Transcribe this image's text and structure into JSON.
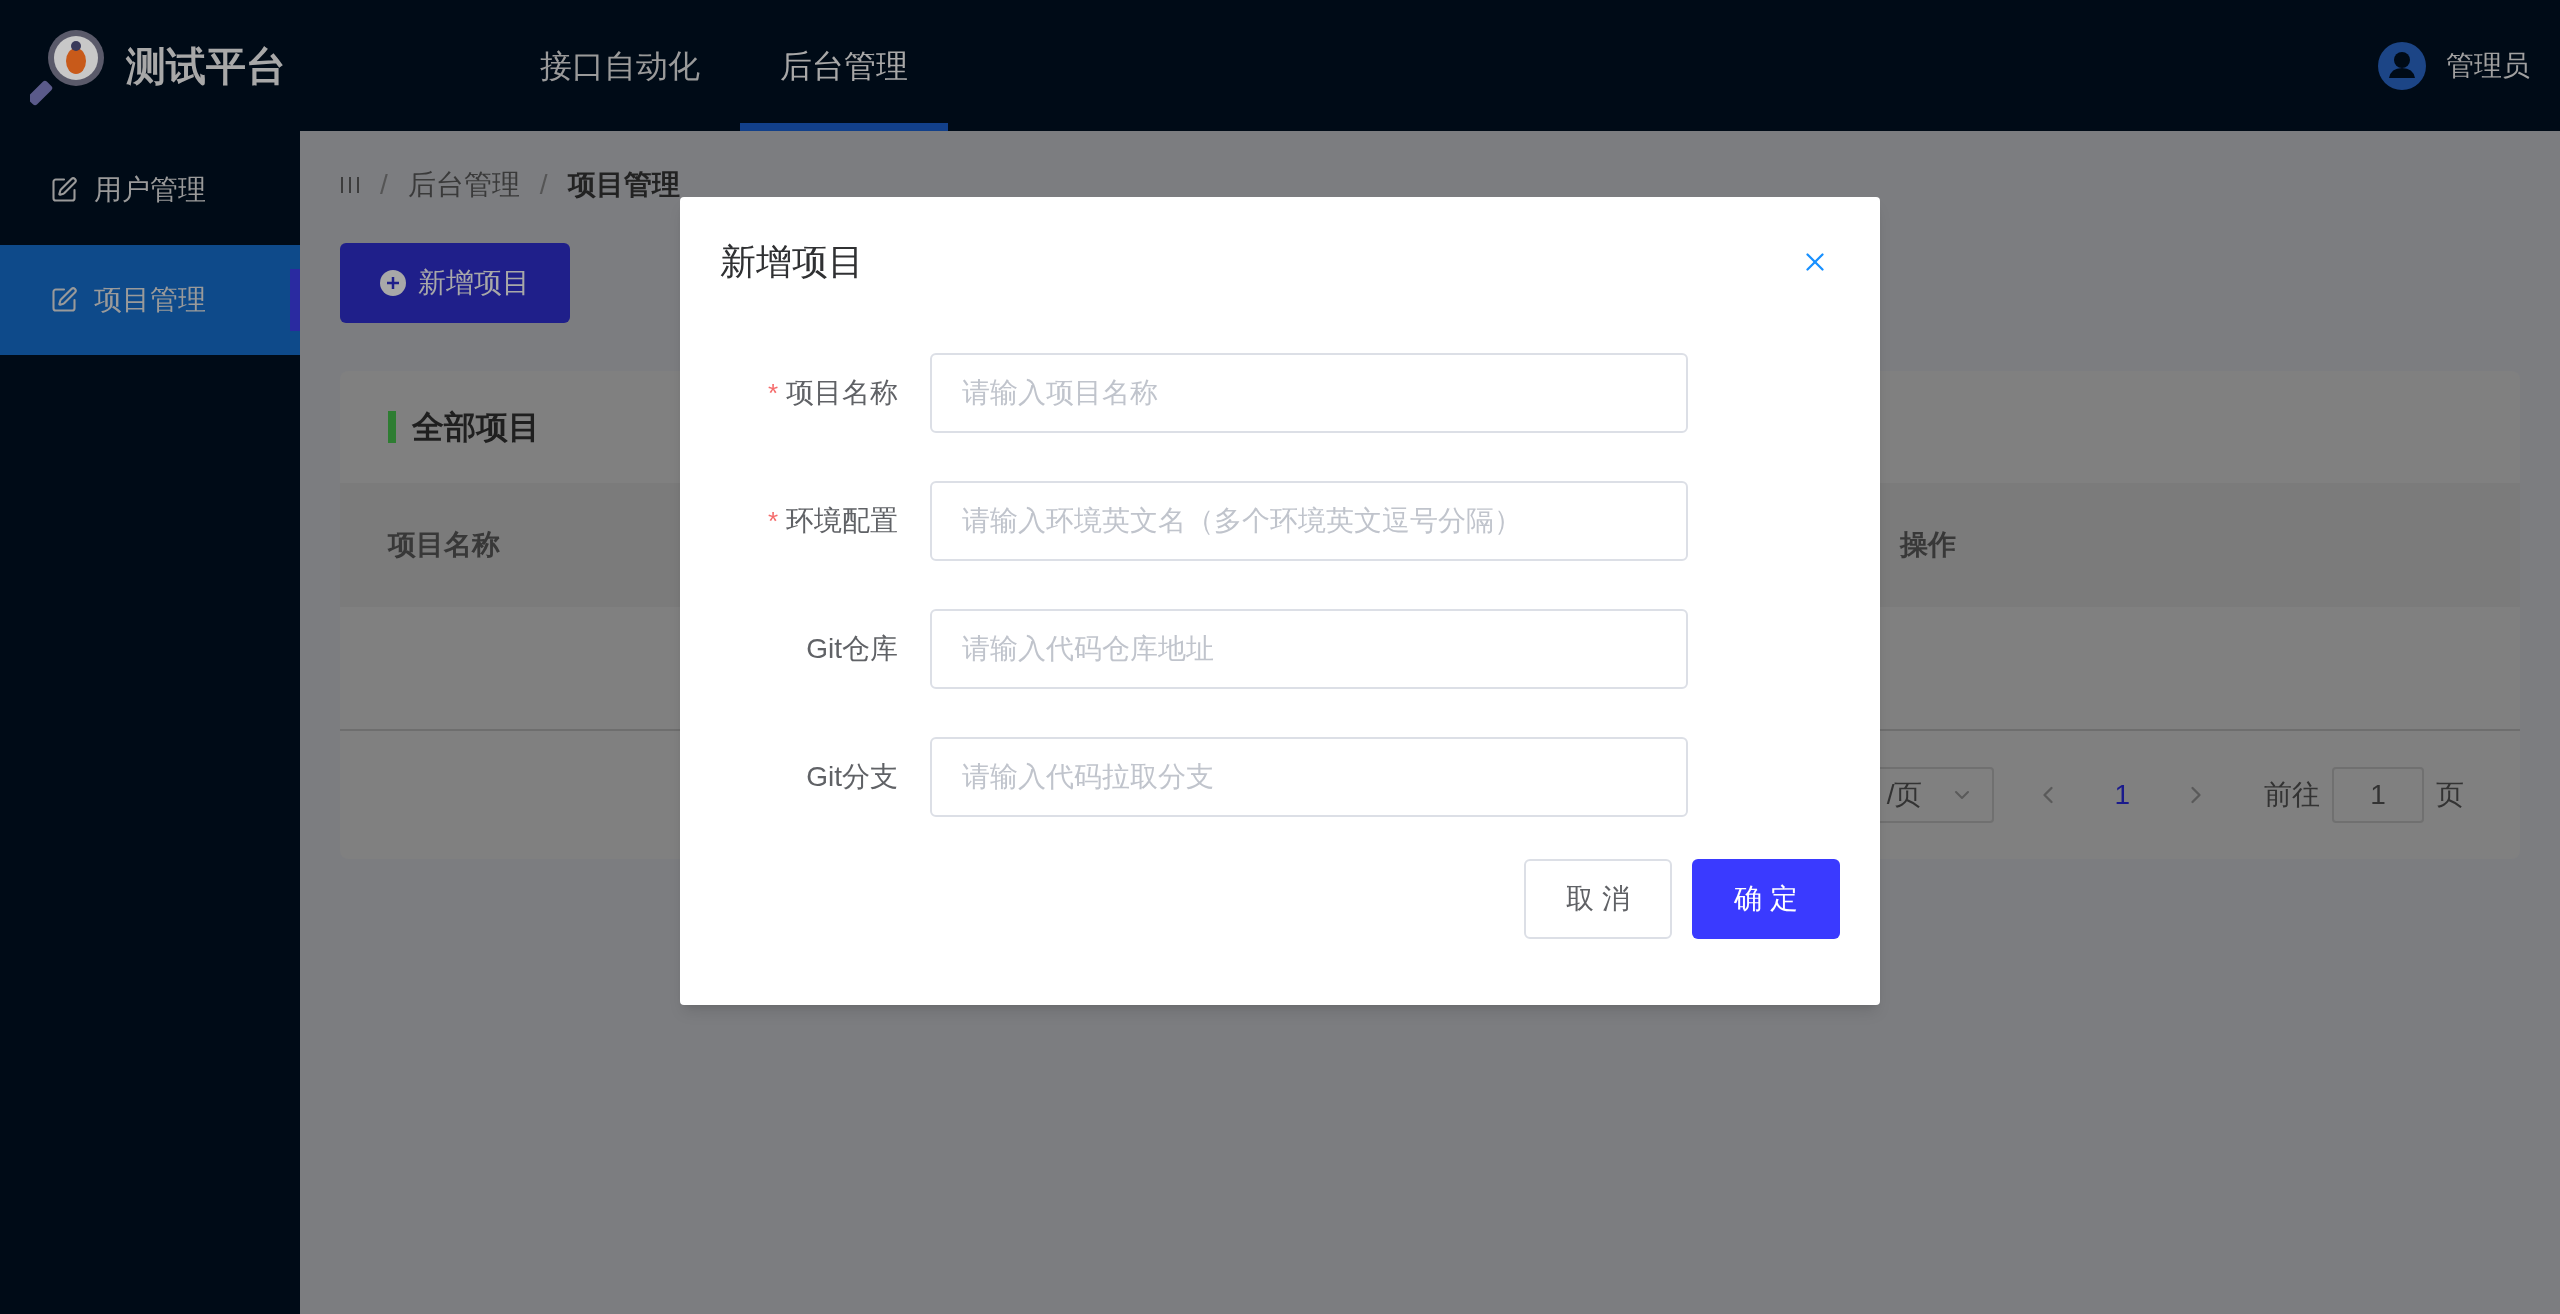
{
  "header": {
    "logo_title": "测试平台",
    "nav": [
      {
        "label": "接口自动化",
        "selected": false
      },
      {
        "label": "后台管理",
        "selected": true
      }
    ],
    "user": "管理员"
  },
  "sidebar": {
    "items": [
      {
        "label": "用户管理",
        "selected": false
      },
      {
        "label": "项目管理",
        "selected": true
      }
    ]
  },
  "breadcrumb": {
    "separator": "/",
    "items": [
      "后台管理",
      "项目管理"
    ]
  },
  "new_button": "新增项目",
  "card": {
    "title": "全部项目",
    "columns": [
      "项目名称",
      "操作"
    ],
    "pagination": {
      "page_size_suffix": "/页",
      "pages": [
        {
          "label": "1",
          "selected": true
        }
      ],
      "goto_label": "前往",
      "goto_value": "1",
      "page_suffix": "页"
    }
  },
  "dialog": {
    "title": "新增项目",
    "required_mark": "*",
    "fields": [
      {
        "label": "项目名称",
        "required": true,
        "placeholder": "请输入项目名称"
      },
      {
        "label": "环境配置",
        "required": true,
        "placeholder": "请输入环境英文名（多个环境英文逗号分隔）"
      },
      {
        "label": "Git仓库",
        "required": false,
        "placeholder": "请输入代码仓库地址"
      },
      {
        "label": "Git分支",
        "required": false,
        "placeholder": "请输入代码拉取分支"
      }
    ],
    "buttons": [
      {
        "label": "取 消",
        "kind": "secondary"
      },
      {
        "label": "确 定",
        "kind": "primary"
      }
    ]
  }
}
